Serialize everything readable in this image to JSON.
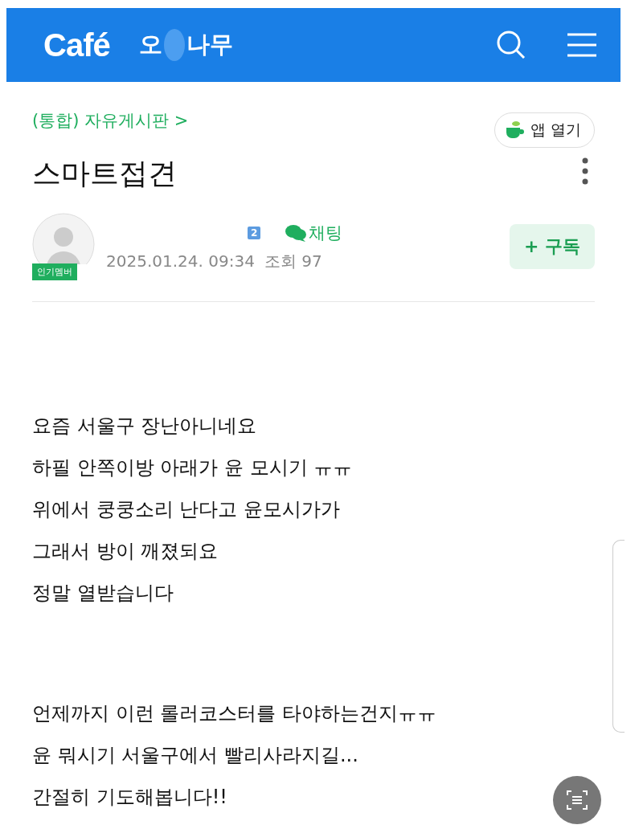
{
  "header": {
    "logo": "Café",
    "cafe_name_start": "오",
    "cafe_name_end": "나무"
  },
  "board": {
    "breadcrumb": "(통합) 자유게시판 >",
    "app_button": "앱 열기"
  },
  "post": {
    "title": "스마트접견",
    "author": {
      "badge": "인기멤버",
      "level": "2",
      "chat": "채팅",
      "date": "2025.01.24. 09:34",
      "views": "조회 97",
      "subscribe": "+ 구독"
    },
    "paragraphs": [
      [
        "요즘 서울구 장난아니네요",
        "하필 안쪽이방 아래가 윤 모시기 ㅠㅠ",
        "위에서 쿵쿵소리 난다고 윤모시가가",
        "그래서 방이 깨졌되요",
        "정말 열받습니다"
      ],
      [
        "언제까지 이런 롤러코스터를 타야하는건지ㅠㅠ",
        "윤 뭐시기 서울구에서 빨리사라지길...",
        "간절히 기도해봅니다!!"
      ]
    ]
  }
}
